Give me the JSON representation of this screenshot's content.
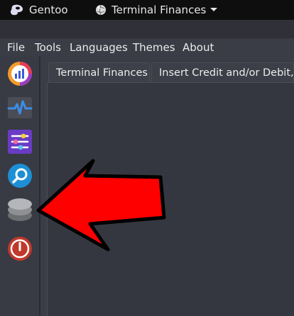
{
  "panel": {
    "os_label": "Gentoo",
    "app_label": "Terminal Finances",
    "os_icon": "gentoo-logo-icon",
    "app_icon": "globe-icon",
    "dropdown_icon": "chevron-down-icon"
  },
  "menubar": {
    "items": [
      "File",
      "Tools",
      "Languages",
      "Themes",
      "About"
    ]
  },
  "sidebar": {
    "items": [
      {
        "name": "chart-app-icon",
        "color": "#e74c3c"
      },
      {
        "name": "activity-pulse-icon",
        "color": "#3b86e6"
      },
      {
        "name": "sliders-icon",
        "color": "#6c3fc5"
      },
      {
        "name": "search-icon",
        "color": "#1d8fd4"
      },
      {
        "name": "database-icon",
        "color": "#a3a3a3"
      },
      {
        "name": "power-icon",
        "color": "#c0392b"
      }
    ]
  },
  "tabs": [
    {
      "label": "Terminal Finances",
      "active": true
    },
    {
      "label": "Insert Credit and/or Debit, Edit",
      "active": false
    }
  ],
  "annotation": {
    "name": "red-arrow-pointer",
    "color": "#ff0000",
    "target": "database-icon"
  }
}
